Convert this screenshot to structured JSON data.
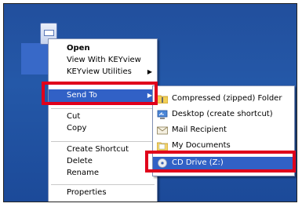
{
  "context_menu": {
    "items": [
      {
        "label": "Open"
      },
      {
        "label": "View With KEYview"
      },
      {
        "label": "KEYview Utilities"
      },
      {
        "label": "Send To"
      },
      {
        "label": "Cut"
      },
      {
        "label": "Copy"
      },
      {
        "label": "Create Shortcut"
      },
      {
        "label": "Delete"
      },
      {
        "label": "Rename"
      },
      {
        "label": "Properties"
      }
    ]
  },
  "send_to_menu": {
    "items": [
      {
        "label": "Compressed (zipped) Folder",
        "icon": "zip-folder-icon"
      },
      {
        "label": "Desktop (create shortcut)",
        "icon": "desktop-shortcut-icon"
      },
      {
        "label": "Mail Recipient",
        "icon": "mail-icon"
      },
      {
        "label": "My Documents",
        "icon": "folder-icon"
      },
      {
        "label": "CD Drive (Z:)",
        "icon": "cd-drive-icon"
      }
    ]
  },
  "colors": {
    "highlight": "#3161c6",
    "annotation_red": "#e0001b",
    "desktop_blue": "#2458a8"
  }
}
